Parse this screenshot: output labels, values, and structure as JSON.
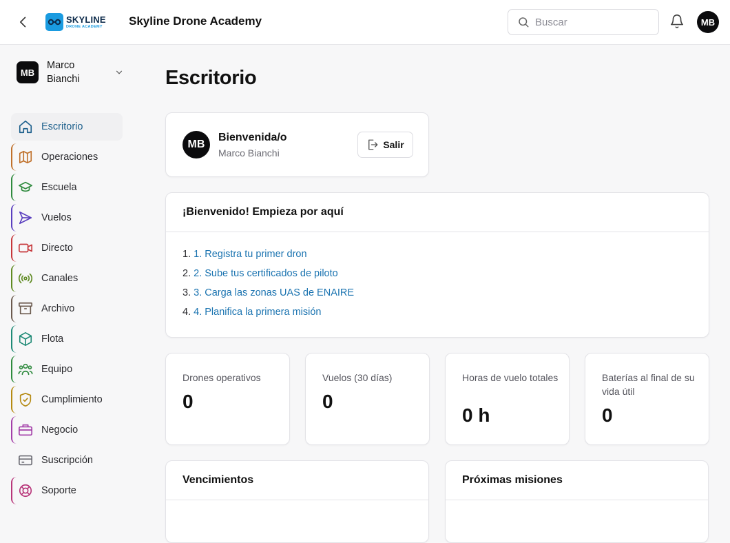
{
  "header": {
    "logo_line1": "SKYLINE",
    "logo_line2": "DRONE ACADEMY",
    "app_title": "Skyline Drone Academy",
    "search_placeholder": "Buscar",
    "avatar_initials": "MB"
  },
  "sidebar": {
    "user": {
      "initials": "MB",
      "name": "Marco Bianchi"
    },
    "items": [
      {
        "label": "Escritorio",
        "icon": "home-icon",
        "color": "#1c5f8c",
        "active": true
      },
      {
        "label": "Operaciones",
        "icon": "map-icon",
        "color": "#c0712b"
      },
      {
        "label": "Escuela",
        "icon": "graduation-cap-icon",
        "color": "#2f8a3e"
      },
      {
        "label": "Vuelos",
        "icon": "send-icon",
        "color": "#5a3fbf"
      },
      {
        "label": "Directo",
        "icon": "video-icon",
        "color": "#c6363a"
      },
      {
        "label": "Canales",
        "icon": "radio-icon",
        "color": "#5f8a22"
      },
      {
        "label": "Archivo",
        "icon": "archive-icon",
        "color": "#6b5a4e"
      },
      {
        "label": "Flota",
        "icon": "box-icon",
        "color": "#1f8a76"
      },
      {
        "label": "Equipo",
        "icon": "users-icon",
        "color": "#2f8a3e"
      },
      {
        "label": "Cumplimiento",
        "icon": "shield-check-icon",
        "color": "#b58a12"
      },
      {
        "label": "Negocio",
        "icon": "briefcase-icon",
        "color": "#a33ea8"
      },
      {
        "label": "Suscripción",
        "icon": "credit-card-icon",
        "color": "#6b6b73"
      },
      {
        "label": "Soporte",
        "icon": "life-buoy-icon",
        "color": "#b8367a"
      }
    ]
  },
  "main": {
    "page_title": "Escritorio",
    "welcome": {
      "initials": "MB",
      "title": "Bienvenida/o",
      "subtitle": "Marco Bianchi",
      "logout_label": "Salir"
    },
    "start": {
      "title": "¡Bienvenido! Empieza por aquí",
      "steps": [
        {
          "num": "1.",
          "label": "1. Registra tu primer dron"
        },
        {
          "num": "2.",
          "label": "2. Sube tus certificados de piloto"
        },
        {
          "num": "3.",
          "label": "3. Carga las zonas UAS de ENAIRE"
        },
        {
          "num": "4.",
          "label": "4. Planifica la primera misión"
        }
      ]
    },
    "stats": [
      {
        "label": "Drones operativos",
        "value": "0"
      },
      {
        "label": "Vuelos (30 días)",
        "value": "0"
      },
      {
        "label": "Horas de vuelo totales",
        "value": "0 h"
      },
      {
        "label": "Baterías al final de su vida útil",
        "value": "0"
      }
    ],
    "bottom": [
      {
        "title": "Vencimientos"
      },
      {
        "title": "Próximas misiones"
      }
    ]
  }
}
